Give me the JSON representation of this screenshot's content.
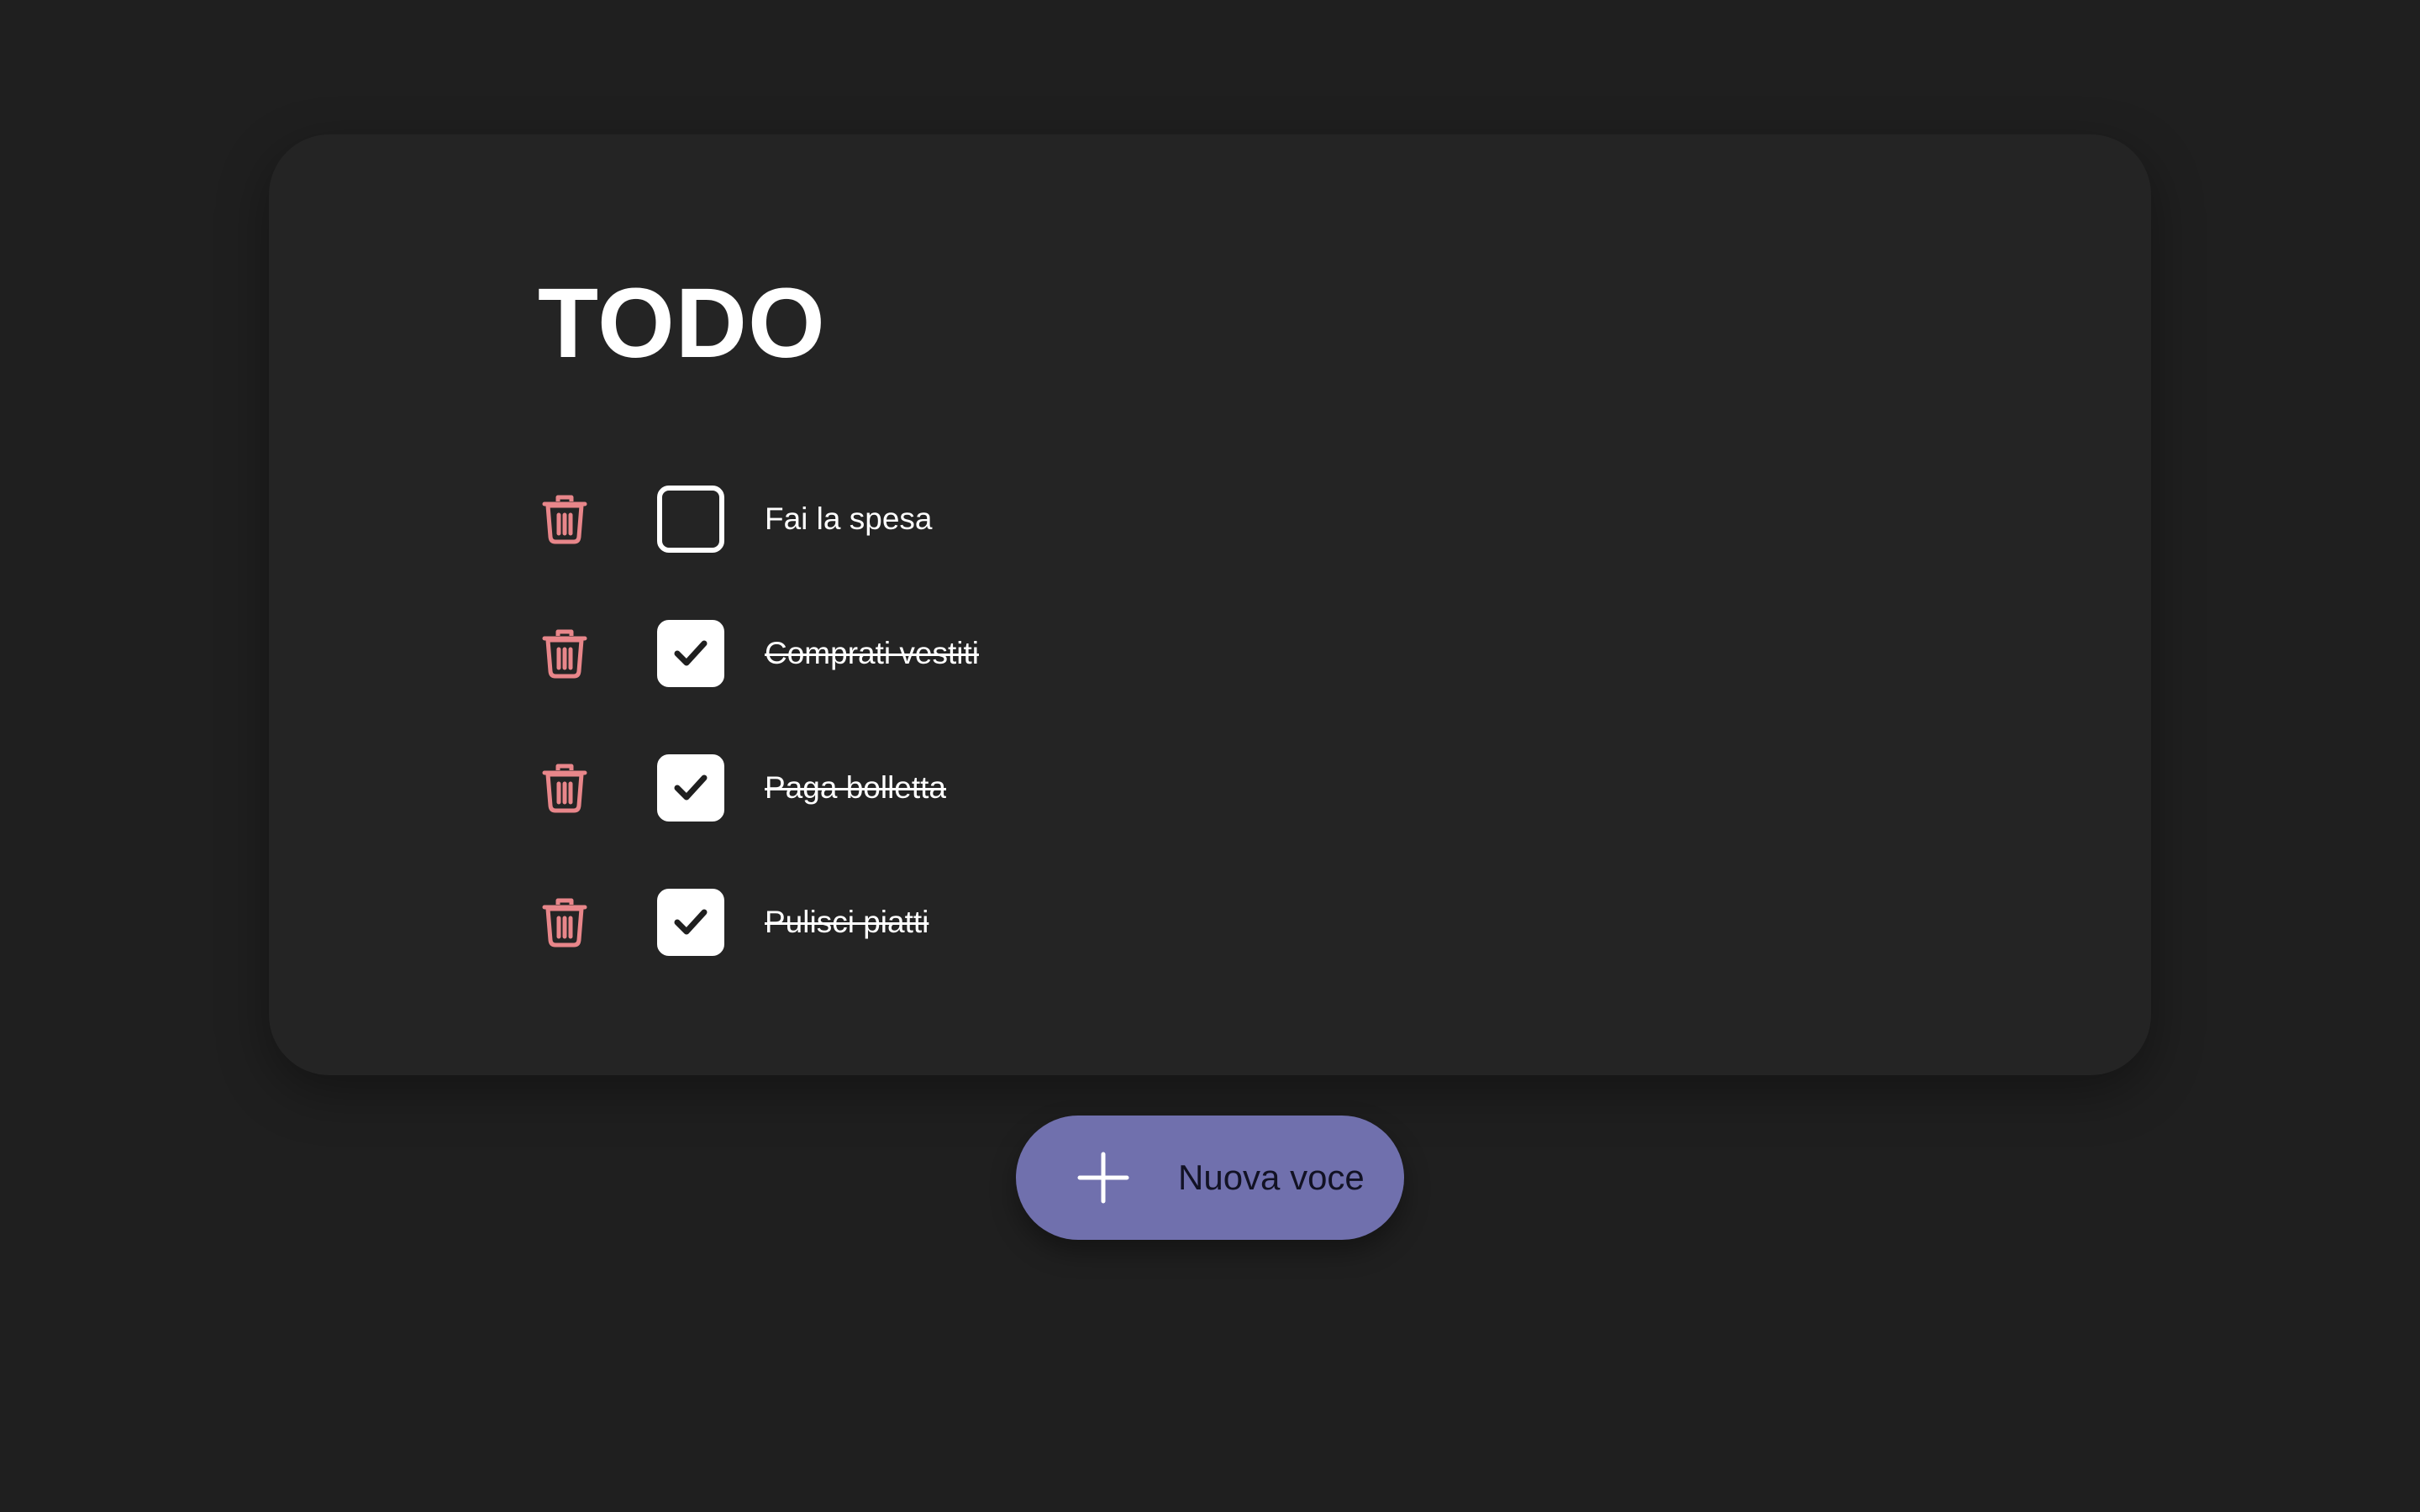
{
  "app": {
    "title": "TODO"
  },
  "todos": [
    {
      "text": "Fai la spesa",
      "done": false
    },
    {
      "text": "Comprati vestiti",
      "done": true
    },
    {
      "text": "Paga bolletta",
      "done": true
    },
    {
      "text": "Pulisci piatti",
      "done": true
    }
  ],
  "icons": {
    "delete": "trash-icon",
    "checked": "checkmark-icon",
    "add": "plus-icon"
  },
  "add_button": {
    "label": "Nuova voce"
  },
  "colors": {
    "background": "#1f1f1f",
    "card": "#242424",
    "trash": "#e8868a",
    "accent": "#7070ad",
    "text": "#ffffff"
  }
}
